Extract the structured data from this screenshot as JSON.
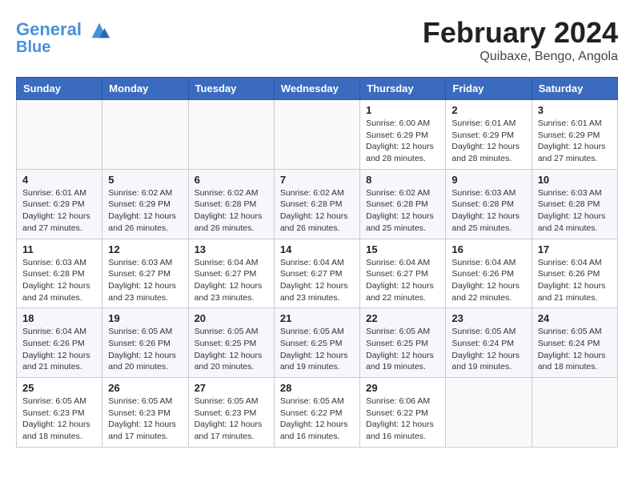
{
  "header": {
    "logo_line1": "General",
    "logo_line2": "Blue",
    "title": "February 2024",
    "subtitle": "Quibaxe, Bengo, Angola"
  },
  "weekdays": [
    "Sunday",
    "Monday",
    "Tuesday",
    "Wednesday",
    "Thursday",
    "Friday",
    "Saturday"
  ],
  "weeks": [
    [
      {
        "day": "",
        "info": ""
      },
      {
        "day": "",
        "info": ""
      },
      {
        "day": "",
        "info": ""
      },
      {
        "day": "",
        "info": ""
      },
      {
        "day": "1",
        "info": "Sunrise: 6:00 AM\nSunset: 6:29 PM\nDaylight: 12 hours\nand 28 minutes."
      },
      {
        "day": "2",
        "info": "Sunrise: 6:01 AM\nSunset: 6:29 PM\nDaylight: 12 hours\nand 28 minutes."
      },
      {
        "day": "3",
        "info": "Sunrise: 6:01 AM\nSunset: 6:29 PM\nDaylight: 12 hours\nand 27 minutes."
      }
    ],
    [
      {
        "day": "4",
        "info": "Sunrise: 6:01 AM\nSunset: 6:29 PM\nDaylight: 12 hours\nand 27 minutes."
      },
      {
        "day": "5",
        "info": "Sunrise: 6:02 AM\nSunset: 6:29 PM\nDaylight: 12 hours\nand 26 minutes."
      },
      {
        "day": "6",
        "info": "Sunrise: 6:02 AM\nSunset: 6:28 PM\nDaylight: 12 hours\nand 26 minutes."
      },
      {
        "day": "7",
        "info": "Sunrise: 6:02 AM\nSunset: 6:28 PM\nDaylight: 12 hours\nand 26 minutes."
      },
      {
        "day": "8",
        "info": "Sunrise: 6:02 AM\nSunset: 6:28 PM\nDaylight: 12 hours\nand 25 minutes."
      },
      {
        "day": "9",
        "info": "Sunrise: 6:03 AM\nSunset: 6:28 PM\nDaylight: 12 hours\nand 25 minutes."
      },
      {
        "day": "10",
        "info": "Sunrise: 6:03 AM\nSunset: 6:28 PM\nDaylight: 12 hours\nand 24 minutes."
      }
    ],
    [
      {
        "day": "11",
        "info": "Sunrise: 6:03 AM\nSunset: 6:28 PM\nDaylight: 12 hours\nand 24 minutes."
      },
      {
        "day": "12",
        "info": "Sunrise: 6:03 AM\nSunset: 6:27 PM\nDaylight: 12 hours\nand 23 minutes."
      },
      {
        "day": "13",
        "info": "Sunrise: 6:04 AM\nSunset: 6:27 PM\nDaylight: 12 hours\nand 23 minutes."
      },
      {
        "day": "14",
        "info": "Sunrise: 6:04 AM\nSunset: 6:27 PM\nDaylight: 12 hours\nand 23 minutes."
      },
      {
        "day": "15",
        "info": "Sunrise: 6:04 AM\nSunset: 6:27 PM\nDaylight: 12 hours\nand 22 minutes."
      },
      {
        "day": "16",
        "info": "Sunrise: 6:04 AM\nSunset: 6:26 PM\nDaylight: 12 hours\nand 22 minutes."
      },
      {
        "day": "17",
        "info": "Sunrise: 6:04 AM\nSunset: 6:26 PM\nDaylight: 12 hours\nand 21 minutes."
      }
    ],
    [
      {
        "day": "18",
        "info": "Sunrise: 6:04 AM\nSunset: 6:26 PM\nDaylight: 12 hours\nand 21 minutes."
      },
      {
        "day": "19",
        "info": "Sunrise: 6:05 AM\nSunset: 6:26 PM\nDaylight: 12 hours\nand 20 minutes."
      },
      {
        "day": "20",
        "info": "Sunrise: 6:05 AM\nSunset: 6:25 PM\nDaylight: 12 hours\nand 20 minutes."
      },
      {
        "day": "21",
        "info": "Sunrise: 6:05 AM\nSunset: 6:25 PM\nDaylight: 12 hours\nand 19 minutes."
      },
      {
        "day": "22",
        "info": "Sunrise: 6:05 AM\nSunset: 6:25 PM\nDaylight: 12 hours\nand 19 minutes."
      },
      {
        "day": "23",
        "info": "Sunrise: 6:05 AM\nSunset: 6:24 PM\nDaylight: 12 hours\nand 19 minutes."
      },
      {
        "day": "24",
        "info": "Sunrise: 6:05 AM\nSunset: 6:24 PM\nDaylight: 12 hours\nand 18 minutes."
      }
    ],
    [
      {
        "day": "25",
        "info": "Sunrise: 6:05 AM\nSunset: 6:23 PM\nDaylight: 12 hours\nand 18 minutes."
      },
      {
        "day": "26",
        "info": "Sunrise: 6:05 AM\nSunset: 6:23 PM\nDaylight: 12 hours\nand 17 minutes."
      },
      {
        "day": "27",
        "info": "Sunrise: 6:05 AM\nSunset: 6:23 PM\nDaylight: 12 hours\nand 17 minutes."
      },
      {
        "day": "28",
        "info": "Sunrise: 6:05 AM\nSunset: 6:22 PM\nDaylight: 12 hours\nand 16 minutes."
      },
      {
        "day": "29",
        "info": "Sunrise: 6:06 AM\nSunset: 6:22 PM\nDaylight: 12 hours\nand 16 minutes."
      },
      {
        "day": "",
        "info": ""
      },
      {
        "day": "",
        "info": ""
      }
    ]
  ]
}
